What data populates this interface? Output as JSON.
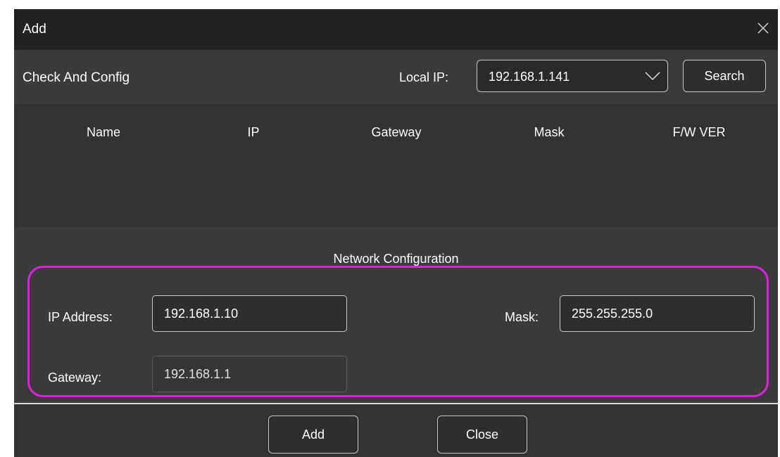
{
  "dialog": {
    "title": "Add",
    "close_icon": "close-icon"
  },
  "toolbar": {
    "section_label": "Check And Config",
    "local_ip_label": "Local IP:",
    "local_ip_value": "192.168.1.141",
    "dropdown_icon": "chevron-down-icon",
    "search_label": "Search"
  },
  "table": {
    "columns": [
      "Name",
      "IP",
      "Gateway",
      "Mask",
      "F/W VER"
    ],
    "rows": []
  },
  "network_config": {
    "title": "Network Configuration",
    "ip_label": "IP Address:",
    "ip_value": "192.168.1.10",
    "mask_label": "Mask:",
    "mask_value": "255.255.255.0",
    "gateway_label": "Gateway:",
    "gateway_value": "192.168.1.1",
    "highlight_color": "#e020e0"
  },
  "footer": {
    "add_label": "Add",
    "close_label": "Close"
  }
}
